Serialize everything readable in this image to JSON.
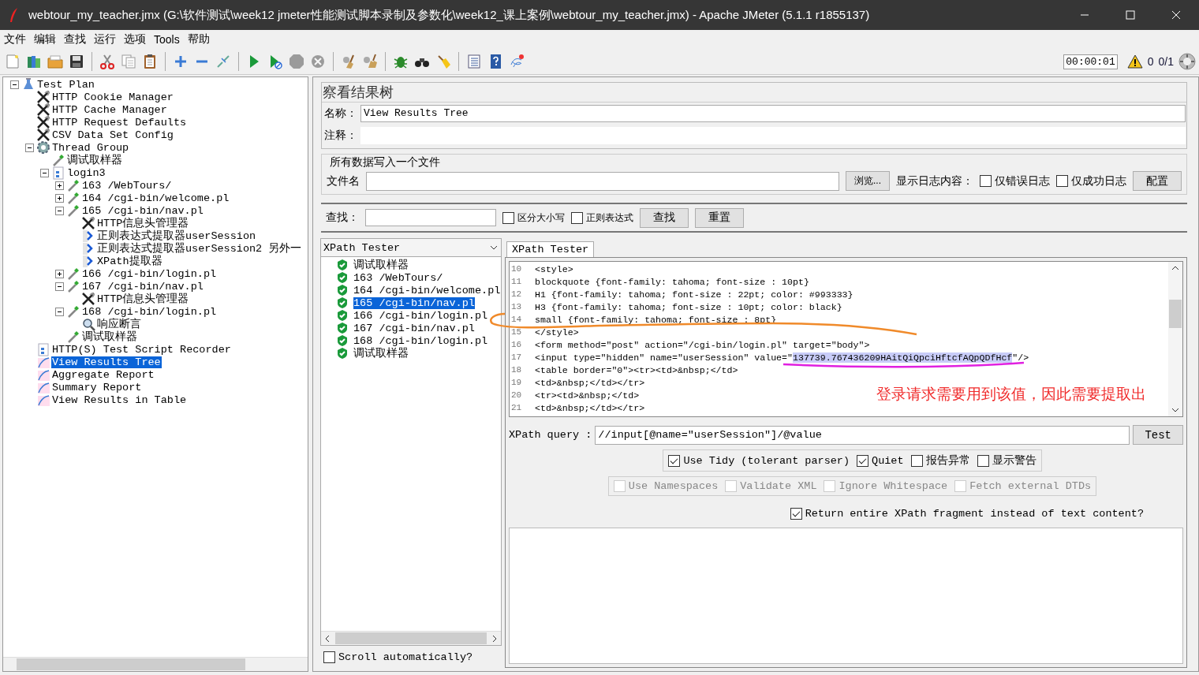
{
  "window": {
    "title": "webtour_my_teacher.jmx (G:\\软件测试\\week12 jmeter性能测试脚本录制及参数化\\week12_课上案例\\webtour_my_teacher.jmx) - Apache JMeter (5.1.1 r1855137)"
  },
  "menu": [
    "文件",
    "编辑",
    "查找",
    "运行",
    "选项",
    "Tools",
    "帮助"
  ],
  "toolbar": [
    [
      {
        "kind": "new",
        "disabled": false
      },
      {
        "kind": "templates",
        "disabled": false
      },
      {
        "kind": "open",
        "disabled": false
      },
      {
        "kind": "save",
        "disabled": false
      }
    ],
    [
      {
        "kind": "cut",
        "disabled": false
      },
      {
        "kind": "copy",
        "disabled": false
      },
      {
        "kind": "paste",
        "disabled": false
      }
    ],
    [
      {
        "kind": "expand",
        "disabled": false
      },
      {
        "kind": "collapse",
        "disabled": false
      },
      {
        "kind": "toggle",
        "disabled": false
      }
    ],
    [
      {
        "kind": "start",
        "disabled": false
      },
      {
        "kind": "start-no-pause",
        "disabled": false
      },
      {
        "kind": "stop",
        "disabled": true
      },
      {
        "kind": "shutdown",
        "disabled": true
      }
    ],
    [
      {
        "kind": "clear",
        "disabled": false
      },
      {
        "kind": "clear-all",
        "disabled": false
      }
    ],
    [
      {
        "kind": "function",
        "disabled": false
      },
      {
        "kind": "search",
        "disabled": false
      },
      {
        "kind": "reset-search",
        "disabled": false
      }
    ],
    [
      {
        "kind": "log",
        "disabled": false
      },
      {
        "kind": "help",
        "disabled": false
      },
      {
        "kind": "remote",
        "disabled": false
      }
    ]
  ],
  "status": {
    "timer": "00:00:01",
    "warnings": "0",
    "threads": "0/1"
  },
  "tree": [
    {
      "label": "Test Plan",
      "kind": "plan",
      "expanded": true,
      "selected": false,
      "children": [
        {
          "label": "HTTP Cookie Manager",
          "kind": "config",
          "selected": false
        },
        {
          "label": "HTTP Cache Manager",
          "kind": "config",
          "selected": false
        },
        {
          "label": "HTTP Request Defaults",
          "kind": "config",
          "selected": false
        },
        {
          "label": "CSV Data Set Config",
          "kind": "config",
          "selected": false
        },
        {
          "label": "Thread Group",
          "kind": "thread",
          "expanded": true,
          "selected": false,
          "children": [
            {
              "label": "调试取样器",
              "kind": "sampler",
              "selected": false
            },
            {
              "label": "login3",
              "kind": "controller",
              "expanded": true,
              "selected": false,
              "children": [
                {
                  "label": "163 /WebTours/",
                  "kind": "sampler",
                  "expanded": false,
                  "selected": false
                },
                {
                  "label": "164 /cgi-bin/welcome.pl",
                  "kind": "sampler",
                  "expanded": false,
                  "selected": false
                },
                {
                  "label": "165 /cgi-bin/nav.pl",
                  "kind": "sampler",
                  "expanded": true,
                  "selected": false,
                  "children": [
                    {
                      "label": "HTTP信息头管理器",
                      "kind": "config",
                      "selected": false
                    },
                    {
                      "label": "正则表达式提取器userSession",
                      "kind": "extractor",
                      "selected": false
                    },
                    {
                      "label": "正则表达式提取器userSession2 另外一",
                      "kind": "extractor",
                      "selected": false
                    },
                    {
                      "label": "XPath提取器",
                      "kind": "extractor",
                      "selected": false
                    }
                  ]
                },
                {
                  "label": "166 /cgi-bin/login.pl",
                  "kind": "sampler",
                  "expanded": false,
                  "selected": false
                },
                {
                  "label": "167 /cgi-bin/nav.pl",
                  "kind": "sampler",
                  "expanded": true,
                  "selected": false,
                  "children": [
                    {
                      "label": "HTTP信息头管理器",
                      "kind": "config",
                      "selected": false
                    }
                  ]
                },
                {
                  "label": "168 /cgi-bin/login.pl",
                  "kind": "sampler",
                  "expanded": true,
                  "selected": false,
                  "children": [
                    {
                      "label": "响应断言",
                      "kind": "assertion",
                      "selected": false
                    }
                  ]
                },
                {
                  "label": "调试取样器",
                  "kind": "sampler",
                  "selected": false
                }
              ]
            }
          ]
        },
        {
          "label": "HTTP(S) Test Script Recorder",
          "kind": "recorder",
          "selected": false
        },
        {
          "label": "View Results Tree",
          "kind": "listener",
          "selected": true
        },
        {
          "label": "Aggregate Report",
          "kind": "listener",
          "selected": false
        },
        {
          "label": "Summary Report",
          "kind": "listener",
          "selected": false
        },
        {
          "label": "View Results in Table",
          "kind": "listener",
          "selected": false
        }
      ]
    }
  ],
  "panel": {
    "title": "察看结果树",
    "name_label": "名称：",
    "name_value": "View Results Tree",
    "comment_label": "注释：",
    "file_group": {
      "legend": "所有数据写入一个文件",
      "file_label": "文件名",
      "browse_button": "浏览...",
      "log_label": "显示日志内容：",
      "checkboxes": [
        {
          "label": "仅错误日志",
          "checked": false
        },
        {
          "label": "仅成功日志",
          "checked": false
        }
      ],
      "config_button": "配置"
    },
    "search": {
      "label": "查找：",
      "checkboxes": [
        {
          "label": "区分大小写",
          "checked": false
        },
        {
          "label": "正则表达式",
          "checked": false
        }
      ],
      "buttons": [
        "查找",
        "重置"
      ]
    }
  },
  "results": {
    "renderer": "XPath Tester",
    "items": [
      {
        "label": "调试取样器",
        "selected": false
      },
      {
        "label": "163 /WebTours/",
        "selected": false
      },
      {
        "label": "164 /cgi-bin/welcome.pl",
        "selected": false
      },
      {
        "label": "165 /cgi-bin/nav.pl",
        "selected": true
      },
      {
        "label": "166 /cgi-bin/login.pl",
        "selected": false
      },
      {
        "label": "167 /cgi-bin/nav.pl",
        "selected": false
      },
      {
        "label": "168 /cgi-bin/login.pl",
        "selected": false
      },
      {
        "label": "调试取样器",
        "selected": false
      }
    ],
    "scroll_checkbox": {
      "label": "Scroll automatically?",
      "checked": false
    }
  },
  "tester": {
    "tab": {
      "label": "XPath Tester",
      "selected": true
    },
    "code_lines": [
      {
        "number": "10",
        "text": "<style>"
      },
      {
        "number": "11",
        "text": "blockquote {font-family: tahoma; font-size : 10pt}"
      },
      {
        "number": "12",
        "text": "H1 {font-family: tahoma; font-size : 22pt; color: #993333}"
      },
      {
        "number": "13",
        "text": "H3 {font-family: tahoma; font-size : 10pt; color: black}"
      },
      {
        "number": "14",
        "text": "small {font-family: tahoma; font-size : 8pt}"
      },
      {
        "number": "15",
        "text": "</style>"
      },
      {
        "number": "16",
        "text": "<form method=\"post\" action=\"/cgi-bin/login.pl\" target=\"body\">"
      },
      {
        "number": "17",
        "parts": [
          {
            "text": "<input type=\"hidden\" name=\"userSession\" value=\"",
            "selected": false
          },
          {
            "text": "137739.767436209HAitQiQpciHftcfAQpQDfHcf",
            "selected": true
          },
          {
            "text": "\"/>",
            "selected": false
          }
        ]
      },
      {
        "number": "18",
        "text": "<table border=\"0\"><tr><td>&nbsp;</td>"
      },
      {
        "number": "19",
        "text": "<td>&nbsp;</td></tr>"
      },
      {
        "number": "20",
        "text": "<tr><td>&nbsp;</td>"
      },
      {
        "number": "21",
        "text": "<td>&nbsp;</td></tr>"
      }
    ],
    "query_label": "XPath query :",
    "query_value": "//input[@name=\"userSession\"]/@value",
    "test_button": "Test",
    "options": [
      {
        "label": "Use Tidy (tolerant parser)",
        "checked": true,
        "disabled": false
      },
      {
        "label": "Quiet",
        "checked": true,
        "disabled": false
      },
      {
        "label": "报告异常",
        "checked": false,
        "disabled": false
      },
      {
        "label": "显示警告",
        "checked": false,
        "disabled": false
      }
    ],
    "advanced": [
      {
        "label": "Use Namespaces",
        "checked": false,
        "disabled": true
      },
      {
        "label": "Validate XML",
        "checked": false,
        "disabled": true
      },
      {
        "label": "Ignore Whitespace",
        "checked": false,
        "disabled": true
      },
      {
        "label": "Fetch external DTDs",
        "checked": false,
        "disabled": true
      }
    ],
    "return_fragment": {
      "label": "Return entire XPath fragment instead of text content?",
      "checked": true
    }
  },
  "annotation": {
    "text": "登录请求需要用到该值，因此需要提取出"
  }
}
